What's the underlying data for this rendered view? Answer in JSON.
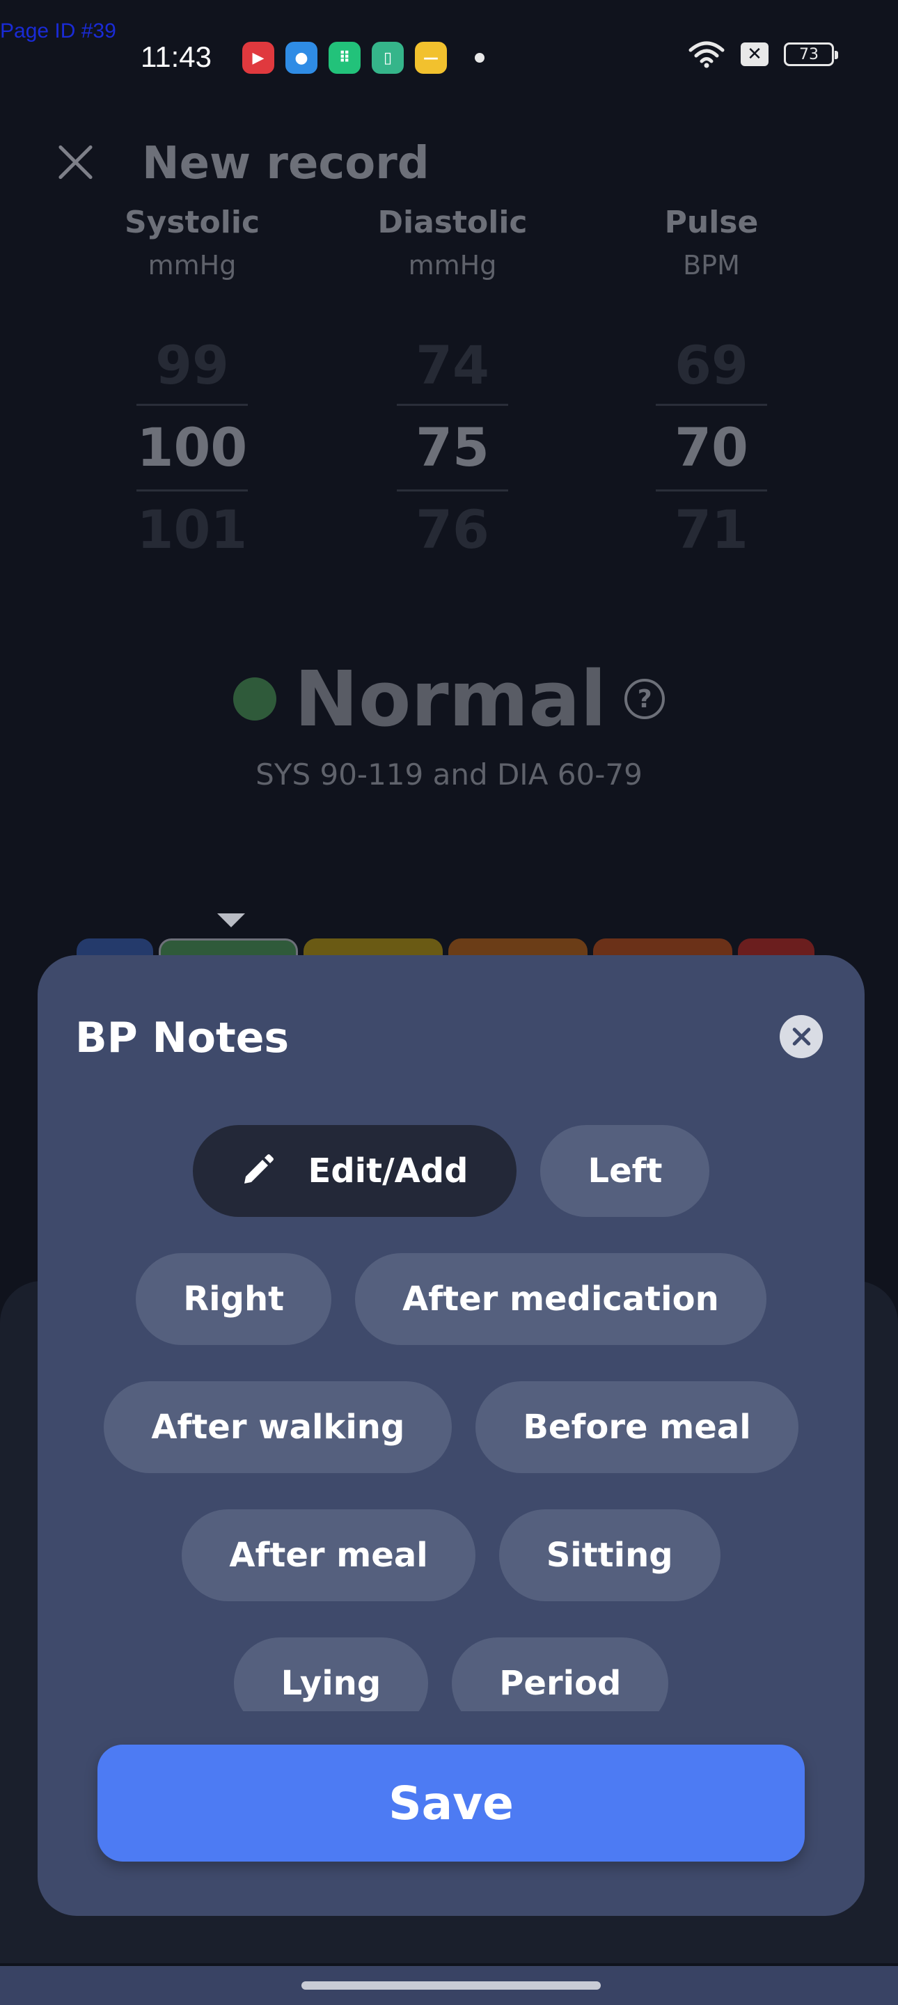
{
  "page_id": "Page ID #39",
  "status_bar": {
    "time": "11:43",
    "battery": "73",
    "notifications": [
      {
        "icon": "play-app-icon",
        "color": "#e0393e",
        "glyph": "▶"
      },
      {
        "icon": "browser-app-icon",
        "color": "#2f8ce5",
        "glyph": "●"
      },
      {
        "icon": "shop-app-icon",
        "color": "#22c27a",
        "glyph": "⠿"
      },
      {
        "icon": "book-app-icon",
        "color": "#35b58a",
        "glyph": "▯"
      },
      {
        "icon": "chat-app-icon",
        "color": "#f2c12e",
        "glyph": "—"
      }
    ]
  },
  "screen": {
    "title": "New record",
    "columns": [
      {
        "label": "Systolic",
        "unit": "mmHg",
        "prev": "99",
        "value": "100",
        "next": "101"
      },
      {
        "label": "Diastolic",
        "unit": "mmHg",
        "prev": "74",
        "value": "75",
        "next": "76"
      },
      {
        "label": "Pulse",
        "unit": "BPM",
        "prev": "69",
        "value": "70",
        "next": "71"
      }
    ],
    "status": "Normal",
    "status_help": "?",
    "status_range": "SYS 90-119 and DIA 60-79",
    "scale_colors": [
      "#243a6b",
      "#2f5a3a",
      "#6a5a14",
      "#6b3d17",
      "#6b3118",
      "#6b1e1e"
    ]
  },
  "modal": {
    "title": "BP Notes",
    "chip_rows": [
      [
        "Edit/Add",
        "Left"
      ],
      [
        "Right",
        "After medication"
      ],
      [
        "After walking",
        "Before meal"
      ],
      [
        "After meal",
        "Sitting"
      ],
      [
        "Lying",
        "Period"
      ]
    ],
    "save_label": "Save"
  }
}
